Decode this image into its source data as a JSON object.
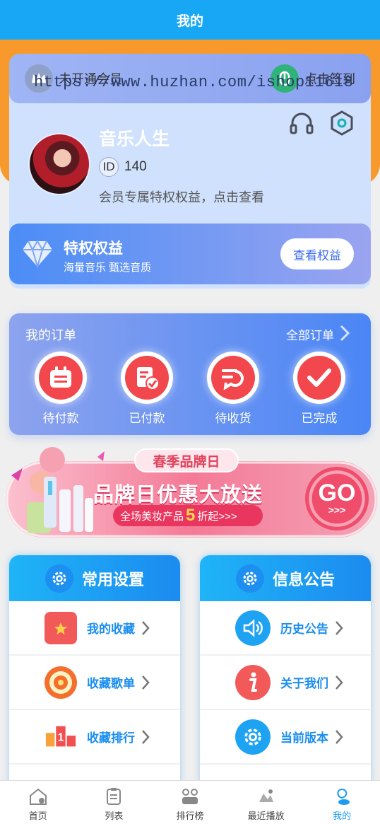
{
  "header": {
    "title": "我的"
  },
  "vip": {
    "left_label": "未开通会员",
    "right_label": "点击签到",
    "watermark": "https://www.huzhan.com/ishop11618"
  },
  "profile": {
    "name": "音乐人生",
    "id_label": "ID",
    "id_value": "140",
    "member_text": "会员专属特权权益，点击查看"
  },
  "privilege": {
    "title": "特权权益",
    "subtitle": "海量音乐 甄选音质",
    "button": "查看权益"
  },
  "orders": {
    "title": "我的订单",
    "all_label": "全部订单",
    "items": [
      {
        "label": "待付款",
        "icon": "wallet-icon"
      },
      {
        "label": "已付款",
        "icon": "paid-doc-icon"
      },
      {
        "label": "待收货",
        "icon": "delivery-icon"
      },
      {
        "label": "已完成",
        "icon": "check-icon"
      }
    ]
  },
  "banner": {
    "tag": "春季品牌日",
    "title": "品牌日优惠大放送",
    "sub_prefix": "全场美妆产品",
    "sub_number": "5",
    "sub_suffix": "折起>>>",
    "go_text": "GO",
    "go_arrows": ">>>"
  },
  "settings_panel": {
    "title": "常用设置",
    "items": [
      {
        "label": "我的收藏",
        "icon": "folder-star-icon"
      },
      {
        "label": "收藏歌单",
        "icon": "vinyl-icon"
      },
      {
        "label": "收藏排行",
        "icon": "ranking-icon"
      }
    ]
  },
  "notice_panel": {
    "title": "信息公告",
    "items": [
      {
        "label": "历史公告",
        "icon": "speaker-icon"
      },
      {
        "label": "关于我们",
        "icon": "info-icon"
      },
      {
        "label": "当前版本",
        "icon": "gear-icon"
      }
    ]
  },
  "tabbar": {
    "items": [
      {
        "label": "首页",
        "icon": "home-icon",
        "active": false
      },
      {
        "label": "列表",
        "icon": "list-icon",
        "active": false
      },
      {
        "label": "排行榜",
        "icon": "ranking-board-icon",
        "active": false
      },
      {
        "label": "最近播放",
        "icon": "recent-play-icon",
        "active": false
      },
      {
        "label": "我的",
        "icon": "me-icon",
        "active": true
      }
    ]
  },
  "colors": {
    "primary": "#17a7f5",
    "accent_orange": "#f8992b",
    "order_red": "#f2474c",
    "brand_pink": "#e9365e"
  }
}
